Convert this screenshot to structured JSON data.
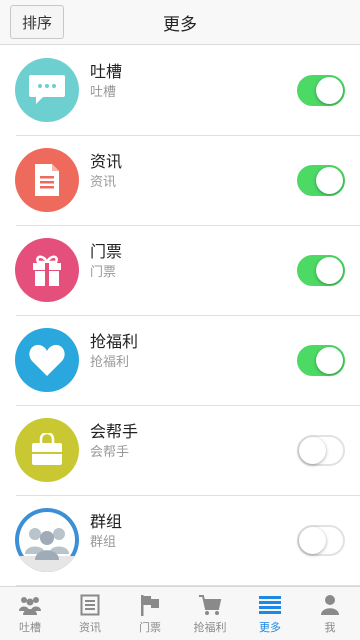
{
  "header": {
    "sort_label": "排序",
    "title": "更多"
  },
  "items": [
    {
      "label": "吐槽",
      "sublabel": "吐槽",
      "icon": "chat-bubble-icon",
      "color": "#6dcfcf",
      "enabled": true
    },
    {
      "label": "资讯",
      "sublabel": "资讯",
      "icon": "document-icon",
      "color": "#ee6a5c",
      "enabled": true
    },
    {
      "label": "门票",
      "sublabel": "门票",
      "icon": "gift-icon",
      "color": "#e54f7c",
      "enabled": true
    },
    {
      "label": "抢福利",
      "sublabel": "抢福利",
      "icon": "heart-icon",
      "color": "#2aa7dc",
      "enabled": true
    },
    {
      "label": "会帮手",
      "sublabel": "会帮手",
      "icon": "shopping-bag-icon",
      "color": "#c9c832",
      "enabled": false
    },
    {
      "label": "群组",
      "sublabel": "群组",
      "icon": "group-people-icon",
      "color": "#3a8fd6",
      "enabled": false
    }
  ],
  "tabs": [
    {
      "label": "吐槽",
      "icon": "people-icon",
      "active": false
    },
    {
      "label": "资讯",
      "icon": "news-icon",
      "active": false
    },
    {
      "label": "门票",
      "icon": "flag-icon",
      "active": false
    },
    {
      "label": "抢福利",
      "icon": "cart-icon",
      "active": false
    },
    {
      "label": "更多",
      "icon": "list-icon",
      "active": true
    },
    {
      "label": "我",
      "icon": "person-icon",
      "active": false
    }
  ],
  "colors": {
    "toggle_on": "#4cd964",
    "tab_active": "#1e88e5",
    "tab_inactive": "#8a8a8a"
  }
}
